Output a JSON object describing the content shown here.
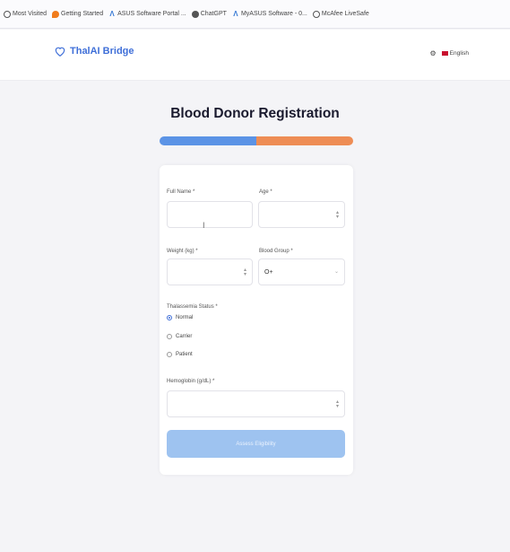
{
  "bookmarks": [
    {
      "label": "Most Visited",
      "icon": "globe-icon"
    },
    {
      "label": "Getting Started",
      "icon": "firefox-icon"
    },
    {
      "label": "ASUS Software Portal ...",
      "icon": "asus-icon"
    },
    {
      "label": "ChatGPT",
      "icon": "chatgpt-icon"
    },
    {
      "label": "MyASUS Software - 0...",
      "icon": "asus-icon"
    },
    {
      "label": "McAfee LiveSafe",
      "icon": "globe-icon"
    }
  ],
  "header": {
    "brand": "ThalAI Bridge",
    "language": "English"
  },
  "page": {
    "title": "Blood Donor Registration"
  },
  "progress": {
    "step": 1,
    "steps": 2
  },
  "form": {
    "full_name_label": "Full Name *",
    "full_name_value": "",
    "age_label": "Age *",
    "age_value": "",
    "weight_label": "Weight (kg) *",
    "weight_value": "",
    "blood_group_label": "Blood Group *",
    "blood_group_value": "O+",
    "thal_status_label": "Thalassemia Status *",
    "thal_options": [
      "Normal",
      "Carrier",
      "Patient"
    ],
    "thal_selected": "Normal",
    "hemoglobin_label": "Hemoglobin (g/dL) *",
    "hemoglobin_value": "",
    "submit_label": "Assess Eligibility"
  },
  "colors": {
    "brand": "#3f6fd8",
    "progress_left": "#5b93e6",
    "progress_right": "#ee8d55",
    "button_disabled": "#9ec3f0"
  }
}
